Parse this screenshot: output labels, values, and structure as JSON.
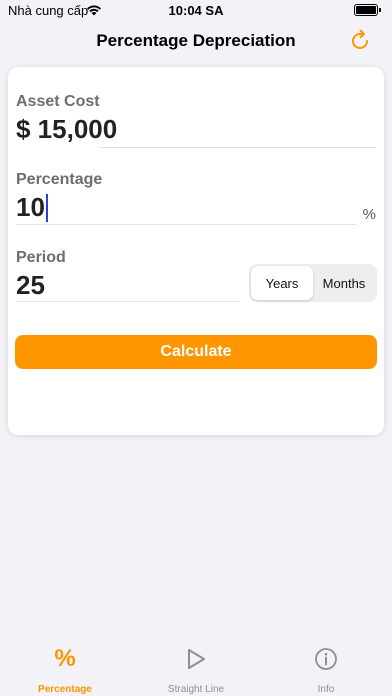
{
  "status_bar": {
    "carrier": "Nhà cung cấp",
    "time": "10:04 SA"
  },
  "nav": {
    "title": "Percentage Depreciation",
    "refresh_icon": "refresh-icon"
  },
  "form": {
    "asset_cost": {
      "label": "Asset Cost",
      "value": "$ 15,000"
    },
    "percentage": {
      "label": "Percentage",
      "value": "10",
      "unit": "%"
    },
    "period": {
      "label": "Period",
      "value": "25",
      "options": [
        "Years",
        "Months"
      ],
      "selected": "Years"
    },
    "calculate_label": "Calculate"
  },
  "tabbar": {
    "items": [
      {
        "label": "Percentage",
        "icon": "percent-icon",
        "active": true
      },
      {
        "label": "Straight Line",
        "icon": "play-icon",
        "active": false
      },
      {
        "label": "Info",
        "icon": "info-icon",
        "active": false
      }
    ]
  },
  "colors": {
    "accent": "#ff9500",
    "caret": "#2c3fd8",
    "background": "#f2f2f7"
  }
}
